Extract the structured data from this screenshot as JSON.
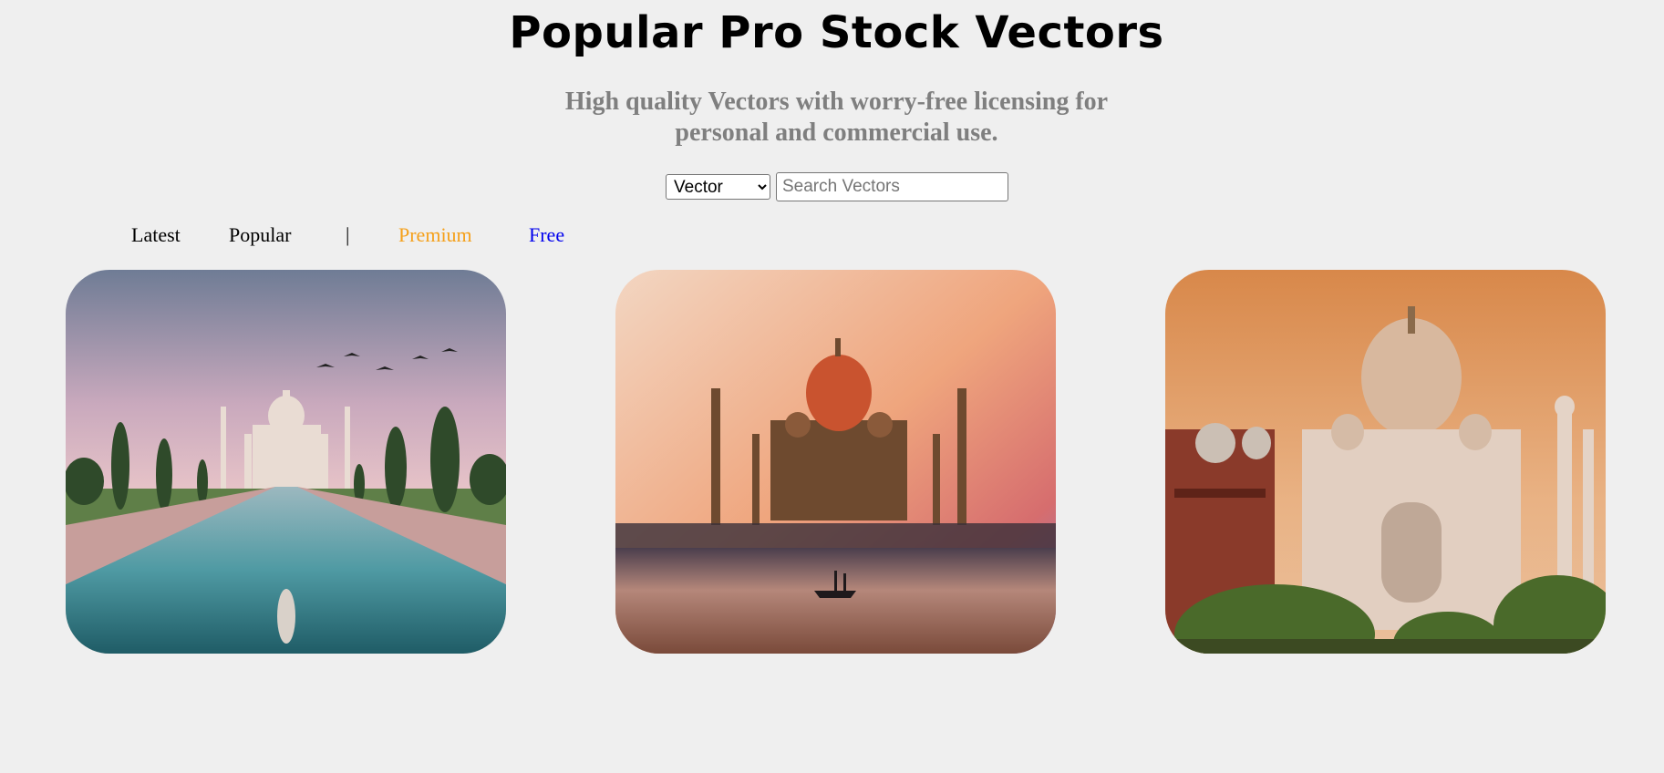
{
  "header": {
    "title": "Popular Pro Stock Vectors",
    "subtitle_line1": "High quality Vectors with worry-free licensing for",
    "subtitle_line2": "personal and commercial use."
  },
  "search": {
    "type_options": [
      "Vector"
    ],
    "type_selected": "Vector",
    "placeholder": "Search Vectors",
    "value": ""
  },
  "nav": {
    "latest": "Latest",
    "popular": "Popular",
    "separator": "|",
    "premium": "Premium",
    "free": "Free"
  },
  "colors": {
    "background": "#efefef",
    "subtitle": "#7f7f7f",
    "premium": "#f5a01a",
    "free": "#0000ee"
  },
  "gallery": {
    "images": [
      {
        "subject": "taj-mahal-reflecting-pool-with-birds"
      },
      {
        "subject": "taj-mahal-painting-with-boat"
      },
      {
        "subject": "taj-mahal-sunset-closeup"
      }
    ]
  }
}
